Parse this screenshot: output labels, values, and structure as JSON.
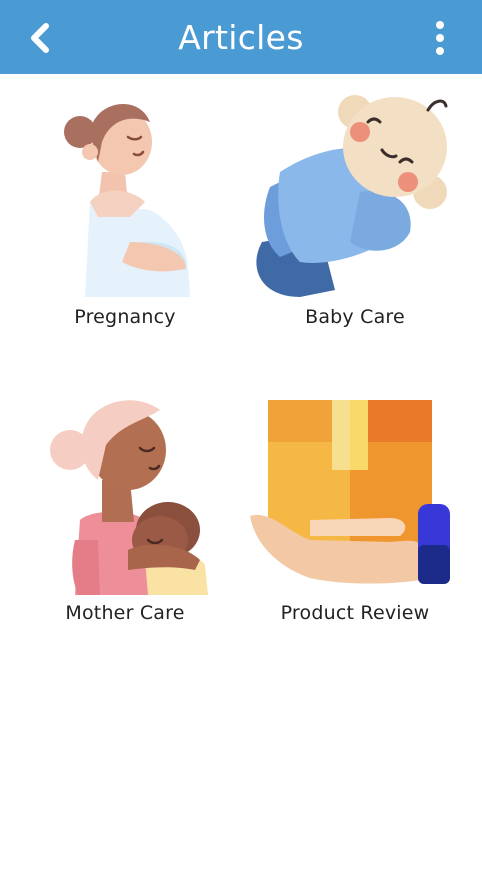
{
  "header": {
    "title": "Articles",
    "back_icon": "chevron-left-icon",
    "menu_icon": "kebab-menu-icon"
  },
  "categories": [
    {
      "label": "Pregnancy",
      "icon": "pregnant-woman-illustration"
    },
    {
      "label": "Baby Care",
      "icon": "swaddled-baby-illustration"
    },
    {
      "label": "Mother Care",
      "icon": "mother-holding-baby-illustration"
    },
    {
      "label": "Product Review",
      "icon": "hand-holding-box-illustration"
    }
  ],
  "colors": {
    "header_bg": "#4a9bd4",
    "header_text": "#ffffff",
    "label_text": "#222222"
  }
}
